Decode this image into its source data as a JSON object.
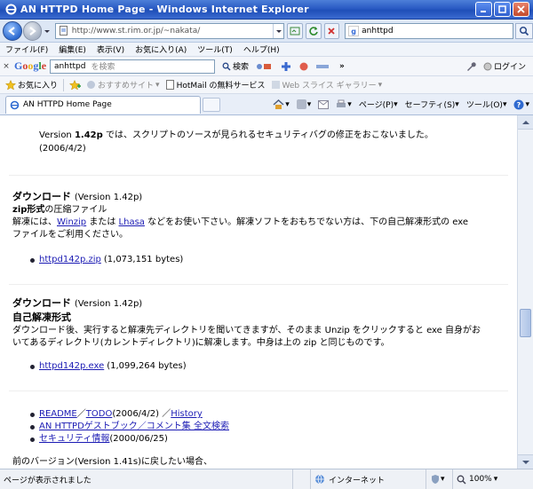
{
  "window": {
    "title": "AN HTTPD Home Page - Windows Internet Explorer"
  },
  "address": {
    "url": "http://www.st.rim.or.jp/~nakata/",
    "search_value": "anhttpd"
  },
  "menu": [
    "ファイル(F)",
    "編集(E)",
    "表示(V)",
    "お気に入り(A)",
    "ツール(T)",
    "ヘルプ(H)"
  ],
  "google_bar": {
    "logo": "Google",
    "query": "anhttpd",
    "placeholder": "を検索",
    "search_label": "検索",
    "more": "»",
    "login_label": "ログイン"
  },
  "favorites_bar": {
    "favorites_label": "お気に入り",
    "items": [
      {
        "label": "おすすめサイト"
      },
      {
        "label": "HotMail の無料サービス"
      },
      {
        "label": "Web スライス ギャラリー"
      }
    ]
  },
  "tab": {
    "title": "AN HTTPD Home Page"
  },
  "commands": {
    "page": "ページ(P)",
    "safety": "セーフティ(S)",
    "tools": "ツール(O)"
  },
  "content": {
    "intro_line1_prefix": "Version ",
    "intro_version": "1.42p",
    "intro_line1_rest": " では、スクリプトのソースが見られるセキュリティバグの修正をおこないました。",
    "intro_date": "(2006/4/2)",
    "section1": {
      "title": "ダウンロード",
      "version": "(Version 1.42p)",
      "subtitle_bold": "zip形式",
      "subtitle_rest": "の圧縮ファイル",
      "desc_prefix": "解凍には、",
      "link_winzip": "Winzip",
      "desc_mid": " または ",
      "link_lhasa": "Lhasa",
      "desc_rest": " などをお使い下さい。解凍ソフトをおもちでない方は、下の自己解凍形式の exe",
      "desc_line2": "ファイルをご利用ください。",
      "file_link": "httpd142p.zip",
      "file_size": "(1,073,151 bytes)"
    },
    "section2": {
      "title": "ダウンロード",
      "version": "(Version 1.42p)",
      "subtitle": "自己解凍形式",
      "desc_line1": "ダウンロード後、実行すると解凍先ディレクトリを聞いてきますが、そのまま Unzip をクリックすると exe 自身がお",
      "desc_line2": "いてあるディレクトリ(カレントディレクトリ)に解凍します。中身は上の zip と同じものです。",
      "file_link": "httpd142p.exe",
      "file_size": "(1,099,264 bytes)"
    },
    "links": {
      "readme": "README",
      "slash1": " ／ ",
      "todo": "TODO",
      "todo_date": "(2006/4/2) ／ ",
      "history": "History",
      "guide": "AN HTTPDゲストブック／コメント集 全文検索",
      "security": "セキュリティ情報",
      "security_date": "(2000/06/25)"
    },
    "prev_version": "前のバージョン(Version 1.41s)に戻したい場合、"
  },
  "status": {
    "text": "ページが表示されました",
    "zone": "インターネット",
    "zoom": "100%"
  }
}
